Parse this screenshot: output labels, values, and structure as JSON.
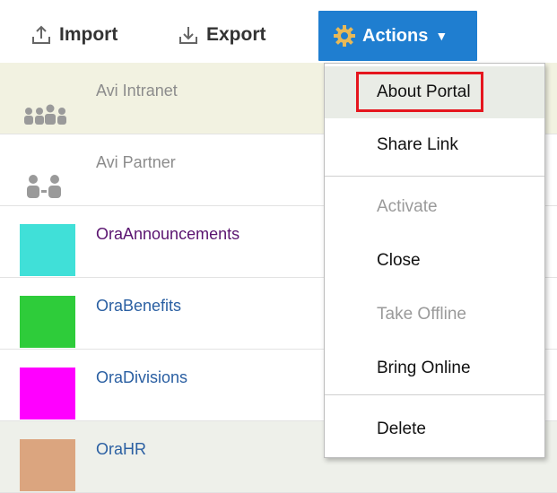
{
  "toolbar": {
    "import_label": "Import",
    "export_label": "Export",
    "actions_label": "Actions",
    "import_icon": "upload-icon",
    "export_icon": "download-icon",
    "actions_icon": "gear-icon",
    "actions_color": "#1f7ed0"
  },
  "portals": [
    {
      "name": "Avi Intranet",
      "thumb": "group-people-icon",
      "color": ""
    },
    {
      "name": "Avi Partner",
      "thumb": "partner-people-icon",
      "color": ""
    },
    {
      "name": "OraAnnouncements",
      "thumb": "color-swatch",
      "color": "#40e0d8"
    },
    {
      "name": "OraBenefits",
      "thumb": "color-swatch",
      "color": "#2ecc3a"
    },
    {
      "name": "OraDivisions",
      "thumb": "color-swatch",
      "color": "#ff00ff"
    },
    {
      "name": "OraHR",
      "thumb": "color-swatch",
      "color": "#dba57f"
    }
  ],
  "menu": {
    "items": [
      {
        "label": "About Portal",
        "enabled": true
      },
      {
        "label": "Share Link",
        "enabled": true
      },
      {
        "label": "Activate",
        "enabled": false
      },
      {
        "label": "Close",
        "enabled": true
      },
      {
        "label": "Take Offline",
        "enabled": false
      },
      {
        "label": "Bring Online",
        "enabled": true
      },
      {
        "label": "Delete",
        "enabled": true
      }
    ],
    "highlight_color": "#e5161e"
  }
}
